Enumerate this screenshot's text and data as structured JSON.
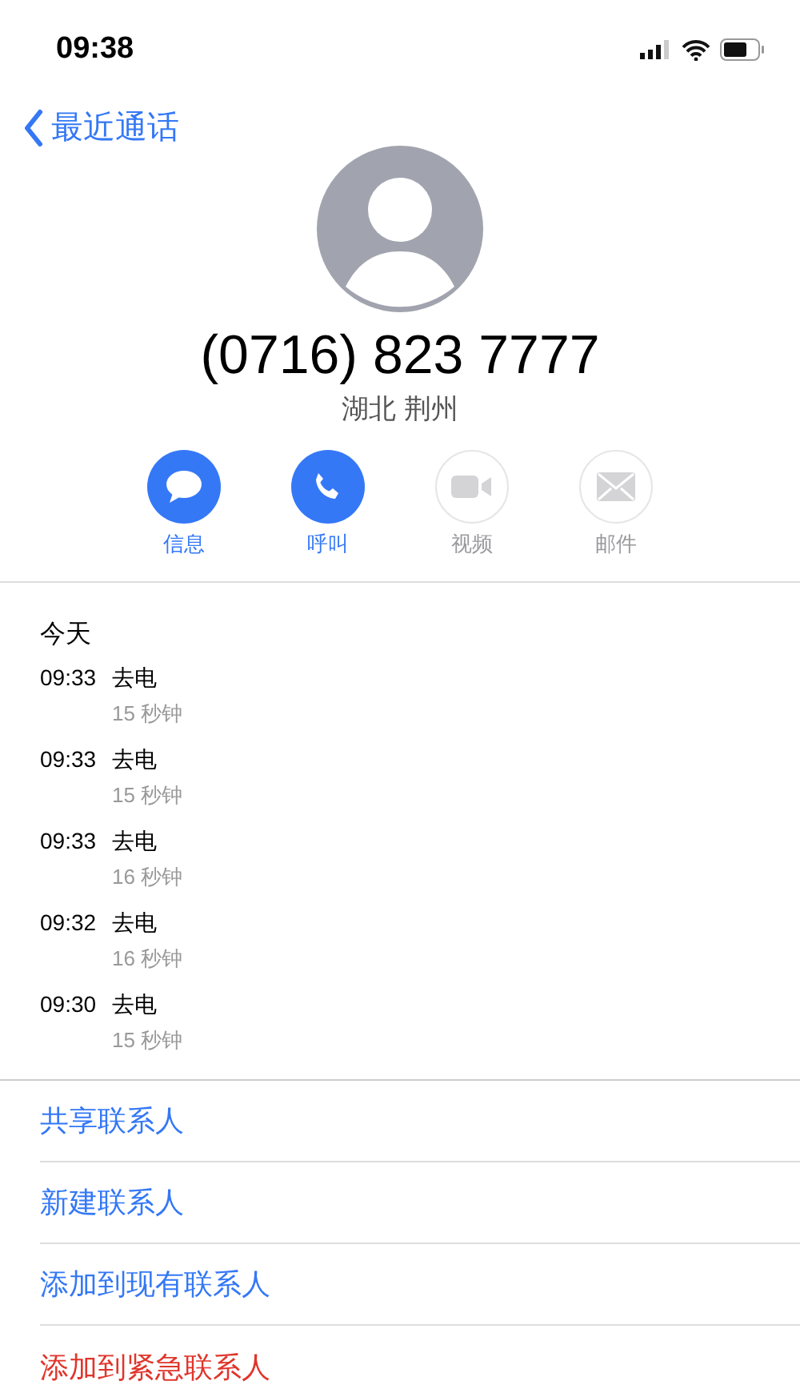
{
  "status_bar": {
    "time": "09:38"
  },
  "nav": {
    "back_label": "最近通话"
  },
  "contact": {
    "number": "(0716) 823 7777",
    "location": "湖北 荆州"
  },
  "actions": [
    {
      "kind": "message",
      "label": "信息",
      "disabled": false
    },
    {
      "kind": "call",
      "label": "呼叫",
      "disabled": false
    },
    {
      "kind": "video",
      "label": "视频",
      "disabled": true
    },
    {
      "kind": "mail",
      "label": "邮件",
      "disabled": true
    }
  ],
  "calls": {
    "header": "今天",
    "items": [
      {
        "time": "09:33",
        "type": "去电",
        "duration": "15 秒钟"
      },
      {
        "time": "09:33",
        "type": "去电",
        "duration": "15 秒钟"
      },
      {
        "time": "09:33",
        "type": "去电",
        "duration": "16 秒钟"
      },
      {
        "time": "09:32",
        "type": "去电",
        "duration": "16 秒钟"
      },
      {
        "time": "09:30",
        "type": "去电",
        "duration": "15 秒钟"
      }
    ]
  },
  "options": [
    {
      "label": "共享联系人",
      "kind": "normal"
    },
    {
      "label": "新建联系人",
      "kind": "normal"
    },
    {
      "label": "添加到现有联系人",
      "kind": "normal"
    },
    {
      "label": "添加到紧急联系人",
      "kind": "destructive"
    }
  ]
}
